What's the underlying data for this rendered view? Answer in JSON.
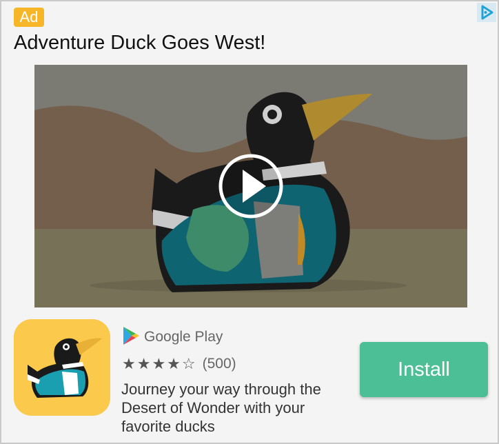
{
  "ad": {
    "badge": "Ad",
    "title": "Adventure Duck Goes West!",
    "app": {
      "store": "Google Play",
      "rating_value": 4,
      "rating_max": 5,
      "stars_filled": "★★★★",
      "stars_empty": "☆",
      "review_count": "(500)",
      "description": "Journey your way through the Desert of Wonder with your favorite ducks"
    },
    "install_label": "Install"
  },
  "colors": {
    "badge": "#f7b628",
    "install_button": "#4cbf96",
    "app_icon_bg": "#fbc94b",
    "adchoices": "#20a4d6"
  },
  "icons": {
    "adchoices": "adchoices-icon",
    "play": "play-icon",
    "store_logo": "google-play-logo-icon",
    "app": "duck-app-icon"
  }
}
